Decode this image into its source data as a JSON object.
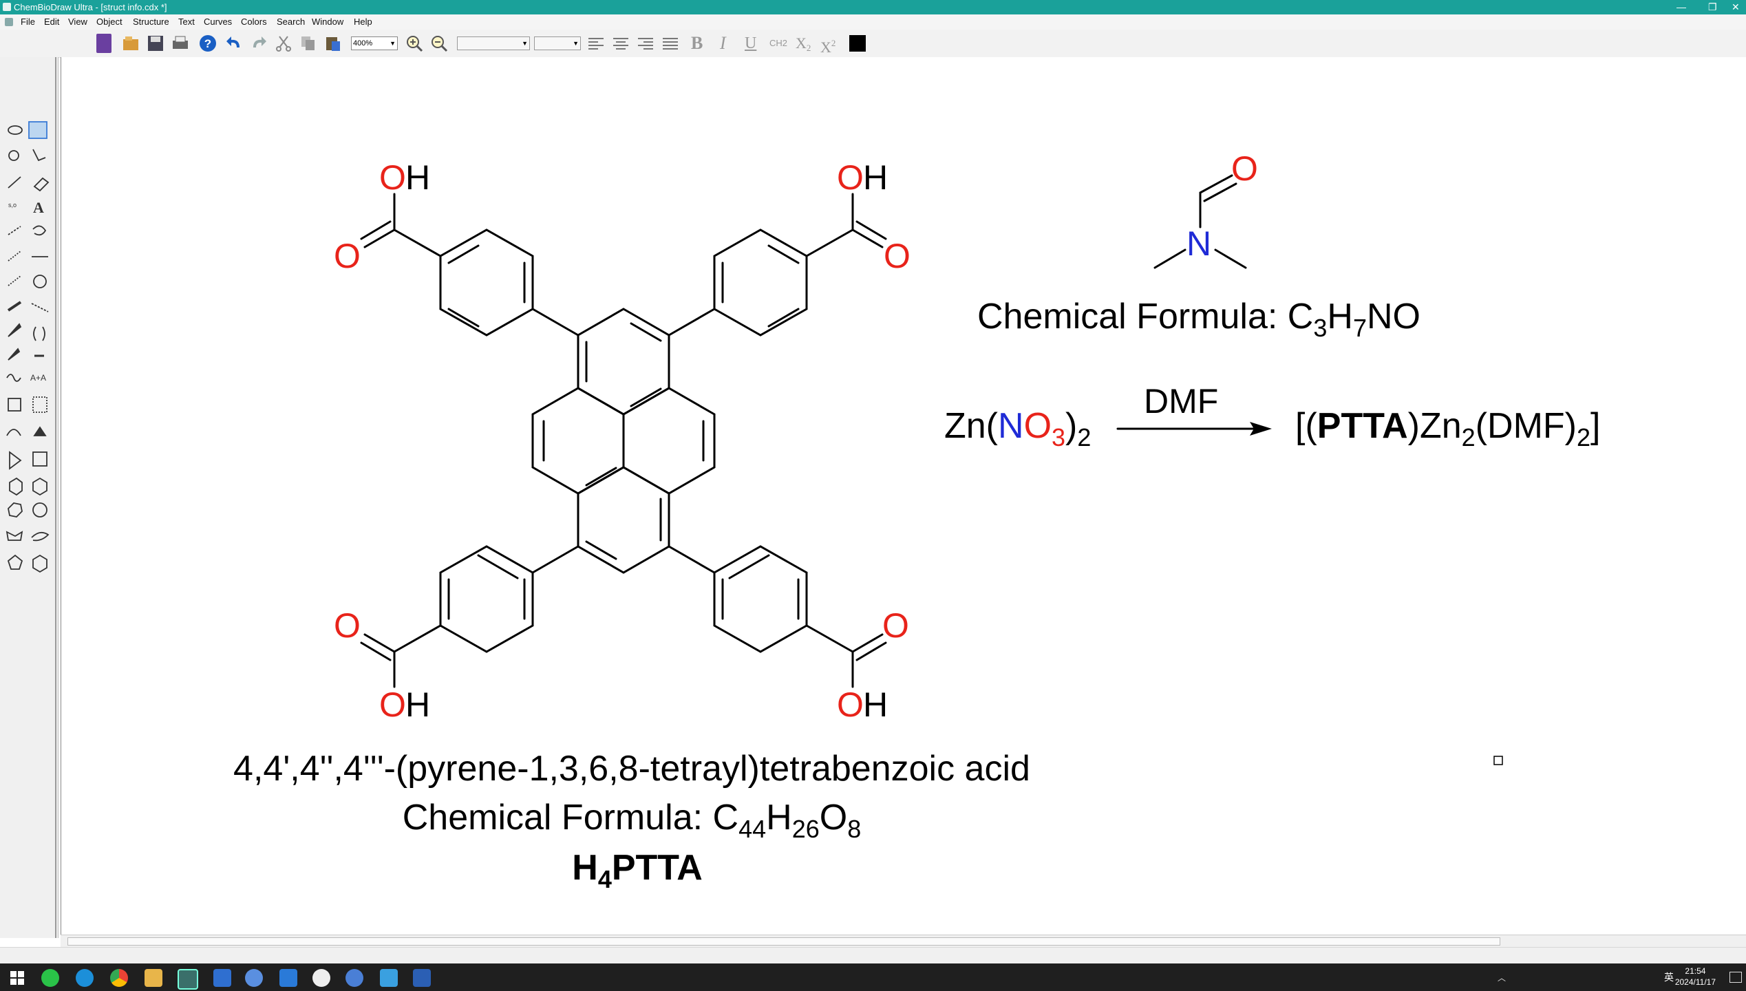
{
  "window": {
    "title": "ChemBioDraw Ultra - [struct info.cdx *]",
    "controls": [
      "—",
      "❐",
      "✕"
    ]
  },
  "menu": [
    "File",
    "Edit",
    "View",
    "Object",
    "Structure",
    "Text",
    "Curves",
    "Colors",
    "Search",
    "Window",
    "Help"
  ],
  "toolbar": {
    "zoom": "400%",
    "sub_label": "X",
    "sub_digit": "2",
    "sup_label": "X",
    "sup_digit": "2",
    "ch2_label": "CH2",
    "bold_label": "B",
    "italic_label": "I",
    "underline_label": "U"
  },
  "canvas": {
    "atoms": {
      "O": "O",
      "H": "H",
      "N": "N"
    },
    "dmf_formula": {
      "prefix": "Chemical Formula: C",
      "c": "3",
      "h_label": "H",
      "h": "7",
      "suffix": "NO"
    },
    "reaction": {
      "reactant_zn": "Zn(",
      "reactant_n": "N",
      "reactant_o": "O",
      "reactant_o_sub": "3",
      "reactant_close": ")",
      "reactant_sub": "2",
      "solvent": "DMF",
      "product_open": "[(",
      "product_ptta": "PTTA",
      "product_zn": ")Zn",
      "product_zn_sub": "2",
      "product_dmf": "(DMF)",
      "product_dmf_sub": "2",
      "product_close": "]"
    },
    "ligand_name": "4,4',4'',4'''-(pyrene-1,3,6,8-tetrayl)tetrabenzoic acid",
    "ligand_formula": {
      "prefix": "Chemical Formula: C",
      "c": "44",
      "h_label": "H",
      "h": "26",
      "o_label": "O",
      "o": "8"
    },
    "ligand_abbr": {
      "h": "H",
      "h_sub": "4",
      "rest": "PTTA"
    }
  },
  "taskbar": {
    "time": "21:54",
    "date": "2024/11/17",
    "ime": "英"
  },
  "colors": {
    "titlebar": "#1aa19a",
    "oxygen": "#e8231a",
    "nitrogen": "#1f2bd6",
    "bond": "#000000"
  }
}
